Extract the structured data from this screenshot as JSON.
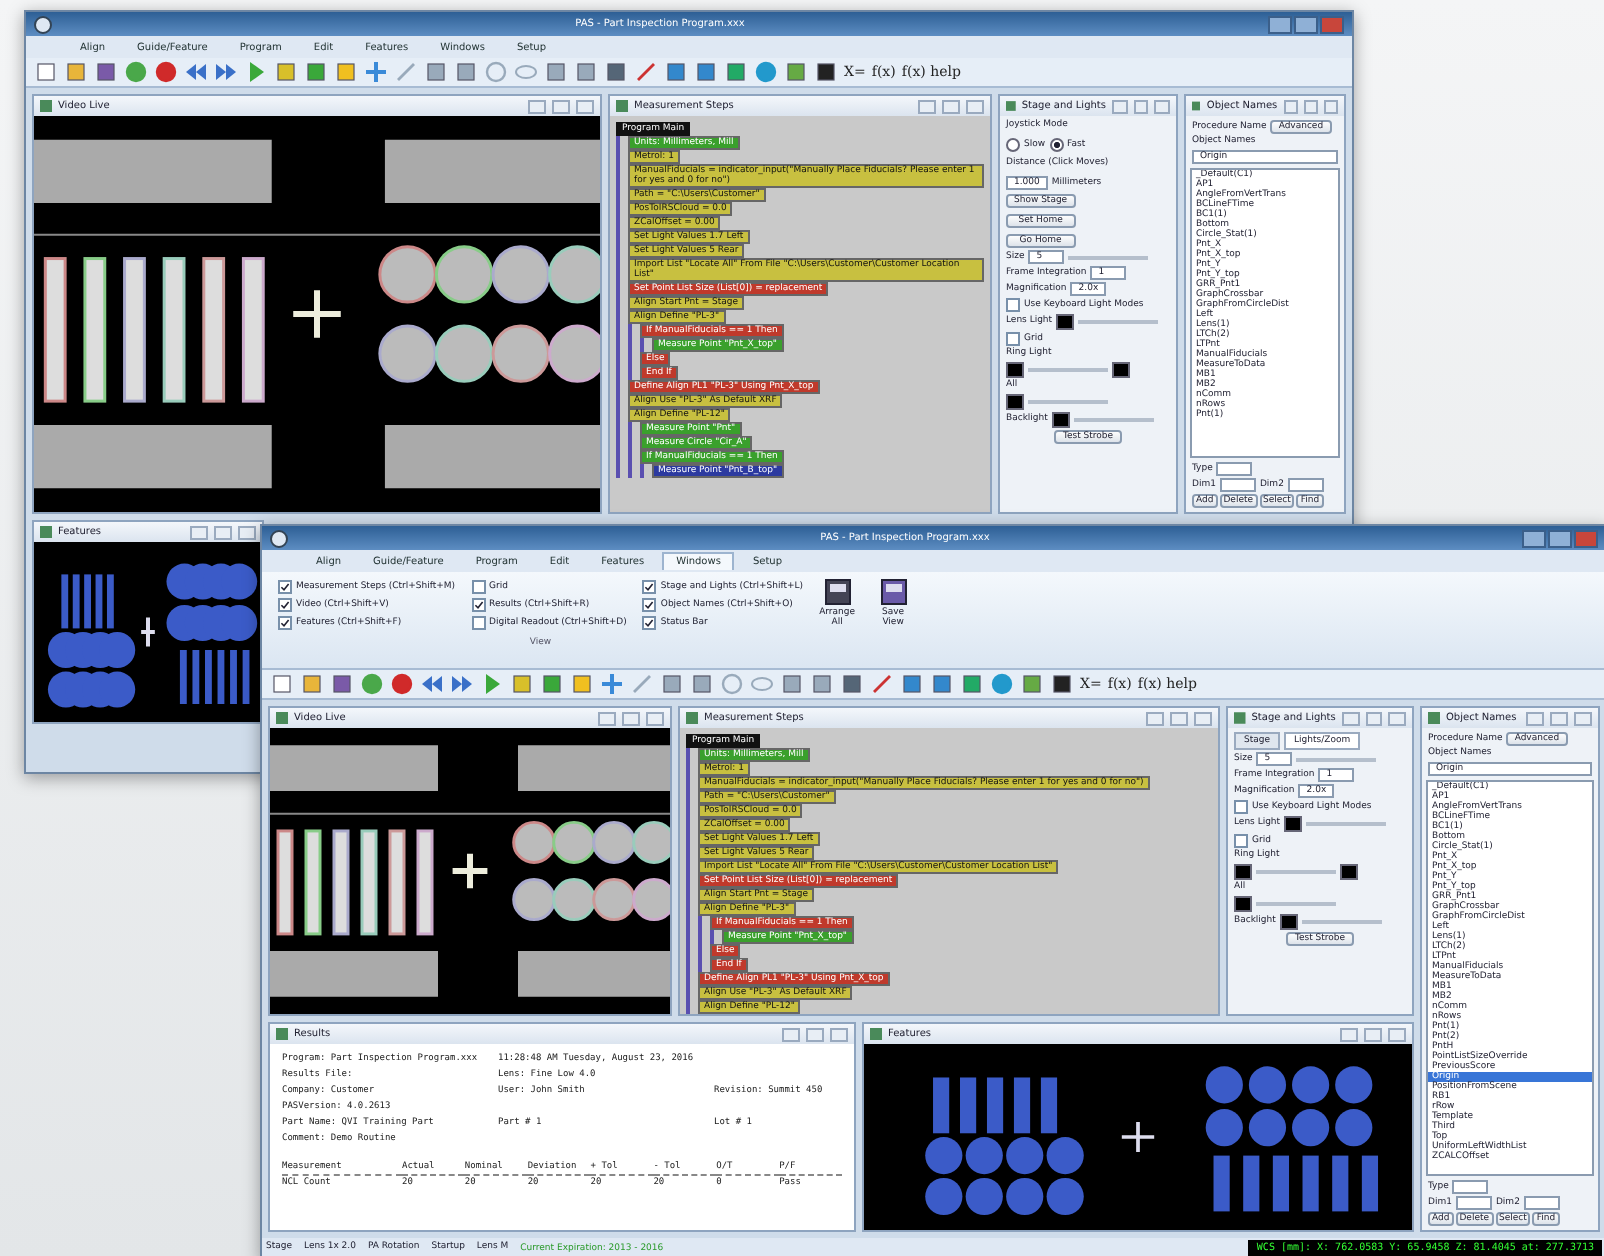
{
  "windows": [
    {
      "title": "PAS - Part Inspection Program.xxx",
      "menu": [
        {
          "label": "Align",
          "selected": false
        },
        {
          "label": "Guide/Feature",
          "selected": false
        },
        {
          "label": "Program",
          "selected": false
        },
        {
          "label": "Edit",
          "selected": false
        },
        {
          "label": "Features",
          "selected": false
        },
        {
          "label": "Windows",
          "selected": false
        },
        {
          "label": "Setup",
          "selected": false
        }
      ],
      "toolbar_labels": [
        "X=",
        "f(x)",
        "f(x) help"
      ],
      "video": {
        "title": "Video Live"
      },
      "steps": {
        "title": "Measurement Steps",
        "header": "Program Main",
        "items": [
          {
            "text": "Units: Millimeters, Mill",
            "color": "#3aa02c"
          },
          {
            "text": "Metrol: 1",
            "color": "#c8c040"
          },
          {
            "text": "ManualFiducials = indicator_input(\"Manually Place Fiducials? Please enter 1 for yes and 0 for no\")",
            "color": "#c8c040"
          },
          {
            "text": "Path = \"C:\\Users\\Customer\"",
            "color": "#c8c040"
          },
          {
            "text": "PosToIRSCloud = 0.0",
            "color": "#c8c040"
          },
          {
            "text": "ZCalOffset = 0.00",
            "color": "#c8c040"
          },
          {
            "text": "Set Light Values 1.7 Left",
            "color": "#c8c040"
          },
          {
            "text": "Set Light Values 5 Rear",
            "color": "#c8c040"
          },
          {
            "text": "Import List \"Locate All\" From File \"C:\\Users\\Customer\\Customer Location List\"",
            "color": "#c8c040"
          },
          {
            "text": "Set Point List Size (List[0]) = replacement",
            "color": "#c0392b"
          },
          {
            "text": "Align Start Pnt = Stage",
            "color": "#c8c040"
          },
          {
            "text": "Align Define \"PL-3\"",
            "color": "#c8c040",
            "children": [
              {
                "text": "If ManualFiducials == 1 Then",
                "color": "#c0392b",
                "children": [
                  {
                    "text": "Measure Point \"Pnt_X_top\"",
                    "color": "#3aa02c"
                  }
                ]
              },
              {
                "text": "Else",
                "color": "#c0392b"
              },
              {
                "text": "End If",
                "color": "#c0392b"
              }
            ]
          },
          {
            "text": "Define Align PL1 \"PL-3\" Using Pnt_X_top",
            "color": "#c0392b"
          },
          {
            "text": "Align Use \"PL-3\" As Default XRF",
            "color": "#c8c040"
          },
          {
            "text": "Align Define \"PL-12\"",
            "color": "#c8c040",
            "children": [
              {
                "text": "Measure Point \"Pnt\"",
                "color": "#3aa02c"
              },
              {
                "text": "Measure Circle \"Cir_A\"",
                "color": "#3aa02c"
              },
              {
                "text": "If ManualFiducials == 1 Then",
                "color": "#3aa02c",
                "children": [
                  {
                    "text": "Measure Point \"Pnt_B_top\"",
                    "color": "#2c3aa0"
                  }
                ]
              }
            ]
          }
        ]
      },
      "stage": {
        "title": "Stage and Lights",
        "joystick_label": "Joystick Mode",
        "modes": [
          {
            "label": "Slow",
            "selected": false
          },
          {
            "label": "Fast",
            "selected": true
          }
        ],
        "stage_buttons": [
          "Show Stage",
          "Set Home",
          "Go Home"
        ],
        "distance_label": "Distance (Click Moves)",
        "distance": "1.000",
        "unit": "Millimeters",
        "size_label": "Size",
        "size": "5",
        "frame_label": "Frame Integration",
        "frame": "1",
        "mag_label": "Magnification",
        "mag": "2.0x",
        "keyboard": {
          "label": "Use Keyboard Light Modes",
          "checked": false
        },
        "lens_label": "Lens Light",
        "grid": {
          "label": "Grid",
          "checked": false
        },
        "ring_label": "Ring Light",
        "all_label": "All",
        "backlight_label": "Backlight",
        "button": "Test Strobe"
      },
      "objects": {
        "title": "Object Names",
        "procedure_label": "Procedure Name",
        "names_label": "Object Names",
        "advanced": "Advanced",
        "search": "Origin",
        "items": [
          {
            "label": "_Default(C1)",
            "selected": false
          },
          {
            "label": "AP1",
            "selected": false
          },
          {
            "label": "AngleFromVertTrans",
            "selected": false
          },
          {
            "label": "BCLineFTime",
            "selected": false
          },
          {
            "label": "BC1(1)",
            "selected": false
          },
          {
            "label": "Bottom",
            "selected": false
          },
          {
            "label": "Circle_Stat(1)",
            "selected": false
          },
          {
            "label": "Pnt_X",
            "selected": false
          },
          {
            "label": "Pnt_X_top",
            "selected": false
          },
          {
            "label": "Pnt_Y",
            "selected": false
          },
          {
            "label": "Pnt_Y_top",
            "selected": false
          },
          {
            "label": "GRR_Pnt1",
            "selected": false
          },
          {
            "label": "GraphCrossbar",
            "selected": false
          },
          {
            "label": "GraphFromCircleDist",
            "selected": false
          },
          {
            "label": "Left",
            "selected": false
          },
          {
            "label": "Lens(1)",
            "selected": false
          },
          {
            "label": "LTCh(2)",
            "selected": false
          },
          {
            "label": "LTPnt",
            "selected": false
          },
          {
            "label": "ManualFiducials",
            "selected": false
          },
          {
            "label": "MeasureToData",
            "selected": false
          },
          {
            "label": "MB1",
            "selected": false
          },
          {
            "label": "MB2",
            "selected": false
          },
          {
            "label": "nComm",
            "selected": false
          },
          {
            "label": "nRows",
            "selected": false
          },
          {
            "label": "Pnt(1)",
            "selected": false
          }
        ],
        "type_label": "Type",
        "dim1_label": "Dim1",
        "dim2_label": "Dim2",
        "buttons": [
          "Add",
          "Delete",
          "Select",
          "Find"
        ]
      },
      "features": {
        "title": "Features"
      }
    },
    {
      "title": "PAS - Part Inspection Program.xxx",
      "menu": [
        {
          "label": "Align",
          "selected": false
        },
        {
          "label": "Guide/Feature",
          "selected": false
        },
        {
          "label": "Program",
          "selected": false
        },
        {
          "label": "Edit",
          "selected": false
        },
        {
          "label": "Features",
          "selected": false
        },
        {
          "label": "Windows",
          "selected": true
        },
        {
          "label": "Setup",
          "selected": false
        }
      ],
      "ribbon": {
        "checks": [
          {
            "label": "Measurement Steps (Ctrl+Shift+M)",
            "checked": true
          },
          {
            "label": "Video (Ctrl+Shift+V)",
            "checked": true
          },
          {
            "label": "Features (Ctrl+Shift+F)",
            "checked": true
          },
          {
            "label": "Grid",
            "checked": false
          },
          {
            "label": "Results (Ctrl+Shift+R)",
            "checked": true
          },
          {
            "label": "Digital Readout (Ctrl+Shift+D)",
            "checked": false
          },
          {
            "label": "Stage and Lights (Ctrl+Shift+L)",
            "checked": true
          },
          {
            "label": "Object Names (Ctrl+Shift+O)",
            "checked": true
          },
          {
            "label": "Status Bar",
            "checked": true
          }
        ],
        "group_label": "View",
        "buttons": [
          "Arrange All",
          "Save View"
        ]
      },
      "toolbar_labels": [
        "X=",
        "f(x)",
        "f(x) help"
      ],
      "video": {
        "title": "Video Live"
      },
      "steps": {
        "title": "Measurement Steps",
        "header": "Program Main",
        "items": [
          {
            "text": "Units: Millimeters, Mill",
            "color": "#3aa02c"
          },
          {
            "text": "Metrol: 1",
            "color": "#c8c040"
          },
          {
            "text": "ManualFiducials = indicator_input(\"Manually Place Fiducials? Please enter 1 for yes and 0 for no\")",
            "color": "#c8c040"
          },
          {
            "text": "Path = \"C:\\Users\\Customer\"",
            "color": "#c8c040"
          },
          {
            "text": "PosToIRSCloud = 0.0",
            "color": "#c8c040"
          },
          {
            "text": "ZCalOffset = 0.00",
            "color": "#c8c040"
          },
          {
            "text": "Set Light Values 1.7 Left",
            "color": "#c8c040"
          },
          {
            "text": "Set Light Values 5 Rear",
            "color": "#c8c040"
          },
          {
            "text": "Import List \"Locate All\" From File \"C:\\Users\\Customer\\Customer Location List\"",
            "color": "#c8c040"
          },
          {
            "text": "Set Point List Size (List[0]) = replacement",
            "color": "#c0392b"
          },
          {
            "text": "Align Start Pnt = Stage",
            "color": "#c8c040"
          },
          {
            "text": "Align Define \"PL-3\"",
            "color": "#c8c040",
            "children": [
              {
                "text": "If ManualFiducials == 1 Then",
                "color": "#c0392b",
                "children": [
                  {
                    "text": "Measure Point \"Pnt_X_top\"",
                    "color": "#3aa02c"
                  }
                ]
              },
              {
                "text": "Else",
                "color": "#c0392b"
              },
              {
                "text": "End If",
                "color": "#c0392b"
              }
            ]
          },
          {
            "text": "Define Align PL1 \"PL-3\" Using Pnt_X_top",
            "color": "#c0392b"
          },
          {
            "text": "Align Use \"PL-3\" As Default XRF",
            "color": "#c8c040"
          },
          {
            "text": "Align Define \"PL-12\"",
            "color": "#c8c040"
          }
        ]
      },
      "stage": {
        "title": "Stage and Lights",
        "tabs": [
          {
            "label": "Stage",
            "selected": false
          },
          {
            "label": "Lights/Zoom",
            "selected": true
          }
        ],
        "size_label": "Size",
        "size": "5",
        "frame_label": "Frame Integration",
        "frame": "1",
        "mag_label": "Magnification",
        "mag": "2.0x",
        "keyboard": {
          "label": "Use Keyboard Light Modes",
          "checked": false
        },
        "lens_label": "Lens Light",
        "grid": {
          "label": "Grid",
          "checked": false
        },
        "ring_label": "Ring Light",
        "all_label": "All",
        "backlight_label": "Backlight",
        "button": "Test Strobe"
      },
      "objects": {
        "title": "Object Names",
        "procedure_label": "Procedure Name",
        "names_label": "Object Names",
        "advanced": "Advanced",
        "search": "Origin",
        "items": [
          {
            "label": "_Default(C1)",
            "selected": false
          },
          {
            "label": "AP1",
            "selected": false
          },
          {
            "label": "AngleFromVertTrans",
            "selected": false
          },
          {
            "label": "BCLineFTime",
            "selected": false
          },
          {
            "label": "BC1(1)",
            "selected": false
          },
          {
            "label": "Bottom",
            "selected": false
          },
          {
            "label": "Circle_Stat(1)",
            "selected": false
          },
          {
            "label": "Pnt_X",
            "selected": false
          },
          {
            "label": "Pnt_X_top",
            "selected": false
          },
          {
            "label": "Pnt_Y",
            "selected": false
          },
          {
            "label": "Pnt_Y_top",
            "selected": false
          },
          {
            "label": "GRR_Pnt1",
            "selected": false
          },
          {
            "label": "GraphCrossbar",
            "selected": false
          },
          {
            "label": "GraphFromCircleDist",
            "selected": false
          },
          {
            "label": "Left",
            "selected": false
          },
          {
            "label": "Lens(1)",
            "selected": false
          },
          {
            "label": "LTCh(2)",
            "selected": false
          },
          {
            "label": "LTPnt",
            "selected": false
          },
          {
            "label": "ManualFiducials",
            "selected": false
          },
          {
            "label": "MeasureToData",
            "selected": false
          },
          {
            "label": "MB1",
            "selected": false
          },
          {
            "label": "MB2",
            "selected": false
          },
          {
            "label": "nComm",
            "selected": false
          },
          {
            "label": "nRows",
            "selected": false
          },
          {
            "label": "Pnt(1)",
            "selected": false
          },
          {
            "label": "Pnt(2)",
            "selected": false
          },
          {
            "label": "PntH",
            "selected": false
          },
          {
            "label": "PointListSizeOverride",
            "selected": false
          },
          {
            "label": "PreviousScore",
            "selected": false
          },
          {
            "label": "Origin",
            "selected": true
          },
          {
            "label": "PositionFromScene",
            "selected": false
          },
          {
            "label": "RB1",
            "selected": false
          },
          {
            "label": "rRow",
            "selected": false
          },
          {
            "label": "Template",
            "selected": false
          },
          {
            "label": "Third",
            "selected": false
          },
          {
            "label": "Top",
            "selected": false
          },
          {
            "label": "UniformLeftWidthList",
            "selected": false
          },
          {
            "label": "ZCALCOffset",
            "selected": false
          }
        ],
        "type_label": "Type",
        "dim1_label": "Dim1",
        "dim2_label": "Dim2",
        "buttons": [
          "Add",
          "Delete",
          "Select",
          "Find"
        ]
      },
      "results": {
        "title": "Results",
        "lines": [
          [
            "Program: Part Inspection Program.xxx",
            "11:28:48 AM  Tuesday, August 23, 2016"
          ],
          [
            "Results File:",
            "Lens: Fine Low 4.0"
          ],
          [
            "Company: Customer",
            "User: John Smith",
            "Revision: Summit 450"
          ],
          [
            "PASVersion: 4.0.2613"
          ],
          [
            "Part Name: QVI Training Part",
            "Part # 1",
            "Lot # 1"
          ],
          [
            "Comment: Demo Routine"
          ]
        ],
        "columns": [
          "Measurement",
          "Actual",
          "Nominal",
          "Deviation",
          "+ Tol",
          "- Tol",
          "O/T",
          "P/F"
        ],
        "rows": [
          [
            "NCL Count",
            "20",
            "20",
            "20",
            "20",
            "20",
            "0",
            "Pass"
          ]
        ]
      },
      "features": {
        "title": "Features"
      },
      "status": [
        "Stage",
        "Lens 1x 2.0",
        "PA Rotation",
        "Startup",
        "Lens M"
      ],
      "status_note": "Current Expiration: 2013 - 2016",
      "dro": "WCS [mm]: X: 762.0583 Y: 65.9458 Z: 81.4045 at: 277.3713"
    }
  ]
}
